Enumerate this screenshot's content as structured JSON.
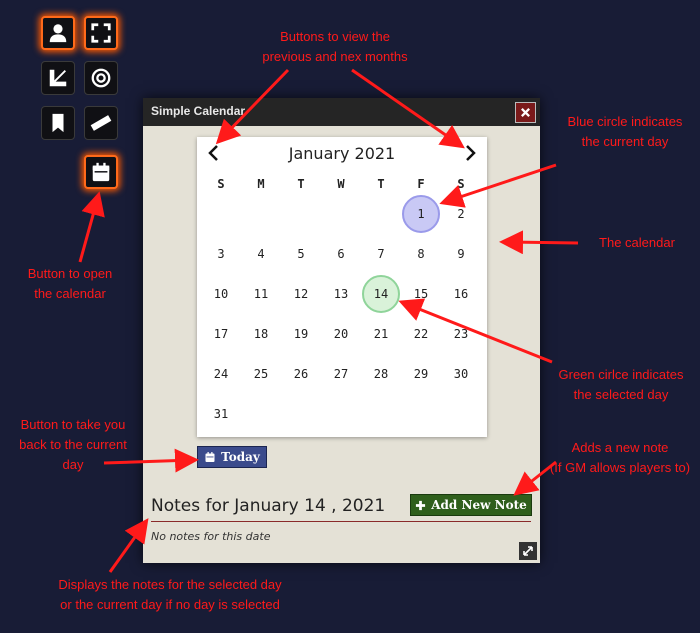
{
  "window": {
    "title": "Simple Calendar"
  },
  "toolbar": {
    "tools": [
      {
        "icon": "user-icon"
      },
      {
        "icon": "fullscreen-icon"
      },
      {
        "icon": "measure-icon"
      },
      {
        "icon": "target-icon"
      },
      {
        "icon": "bookmark-icon"
      },
      {
        "icon": "ruler-icon"
      },
      {
        "icon": "calendar-icon",
        "active": true
      }
    ]
  },
  "calendar": {
    "month_label": "January 2021",
    "weekdays": [
      "S",
      "M",
      "T",
      "W",
      "T",
      "F",
      "S"
    ],
    "first_weekday_index": 5,
    "days_in_month": 31,
    "current_day": 1,
    "selected_day": 14
  },
  "buttons": {
    "today_label": "Today",
    "add_note_label": "Add New Note"
  },
  "notes": {
    "title": "Notes for January 14 , 2021",
    "empty_text": "No notes for this date"
  },
  "annotations": {
    "nav_buttons": [
      "Buttons to view the",
      "previous and nex months"
    ],
    "blue_circle": [
      "Blue circle indicates",
      "the current day"
    ],
    "the_calendar": [
      "The calendar"
    ],
    "open_button": [
      "Button to open",
      "the calendar"
    ],
    "green_circle": [
      "Green cirlce indicates",
      "the selected day"
    ],
    "today_button": [
      "Button to take you",
      "back to the current",
      "day"
    ],
    "add_note": [
      "Adds a new note",
      "(If GM allows players to)"
    ],
    "notes_display": [
      "Displays the notes for the selected day",
      "or the current day if no day is selected"
    ]
  },
  "colors": {
    "background": "#181c36",
    "annotation": "#ff1a1a",
    "current_day": "#c9c9f5",
    "selected_day": "#d9f2d9",
    "today_button": "#3b4b8c",
    "add_button": "#2f5f1c"
  }
}
